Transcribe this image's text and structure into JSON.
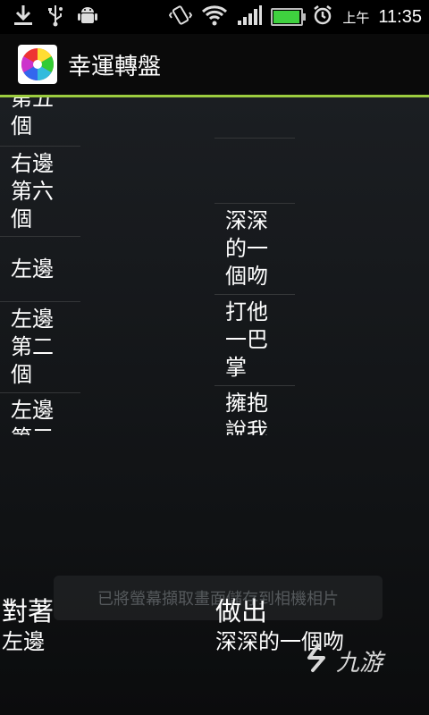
{
  "status_bar": {
    "ampm": "上午",
    "time": "11:35",
    "battery_level": 0.9
  },
  "app": {
    "title": "幸運轉盤"
  },
  "wheel_left": {
    "items": [
      "第五\n個",
      "右邊\n第六\n個",
      "左邊",
      "左邊\n第二\n個",
      "左邊\n第三"
    ]
  },
  "wheel_right": {
    "items": [
      "",
      "",
      "深深\n的一\n個吻",
      "打他\n一巴\n掌",
      "擁抱\n說我"
    ]
  },
  "toast": {
    "message": "已將螢幕擷取畫面儲存到相機相片"
  },
  "result": {
    "left_title": "對著",
    "left_value": "左邊",
    "right_title": "做出",
    "right_value": "深深的一個吻"
  },
  "watermark": {
    "text": "九游"
  },
  "colors": {
    "accent": "#9ccc3f",
    "battery": "#3fd13f"
  }
}
